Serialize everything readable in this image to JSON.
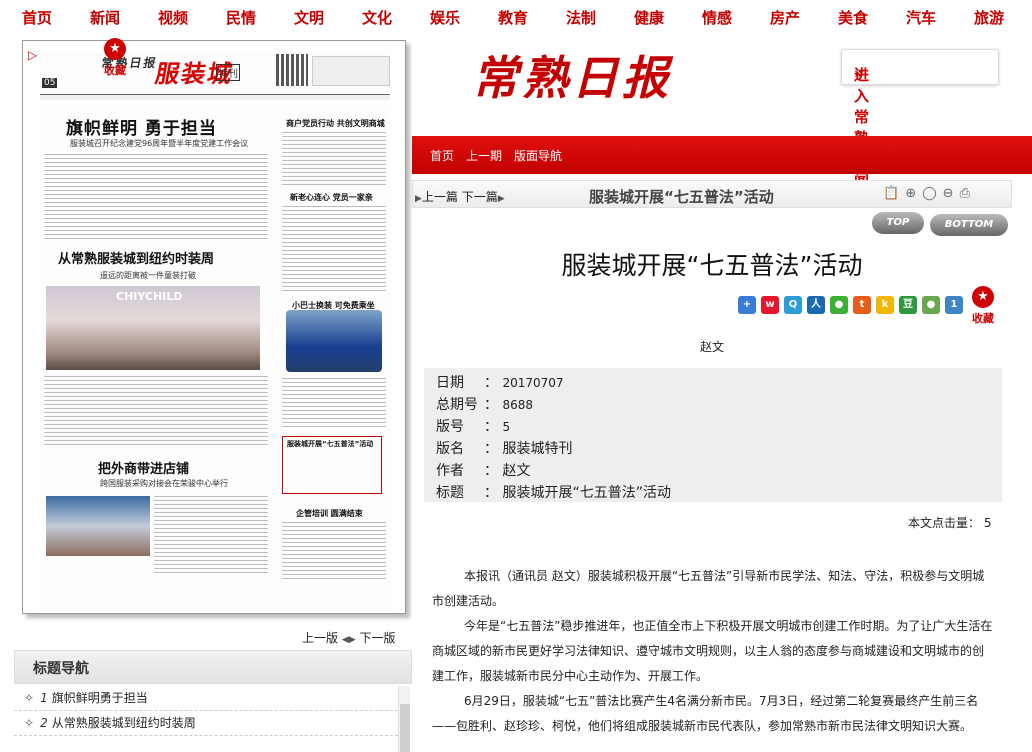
{
  "topnav": [
    "首页",
    "新闻",
    "视频",
    "民情",
    "文明",
    "文化",
    "娱乐",
    "教育",
    "法制",
    "健康",
    "情感",
    "房产",
    "美食",
    "汽车",
    "旅游"
  ],
  "colors": {
    "brand_red": "#c40000",
    "info_bg": "#eeeeee"
  },
  "paper": {
    "favorite_label": "收藏",
    "page_num": "05",
    "masthead_name": "服装城",
    "masthead_tag": "特刊",
    "masthead_logo": "常熟日报",
    "headline1": "旗帜鲜明  勇于担当",
    "sub1": "服装城召开纪念建党96周年暨半年度党建工作会议",
    "headline2": "从常熟服装城到纽约时装周",
    "sub2": "遥远的距离被一件童装打破",
    "photo_brand": "CHIYCHILD",
    "headline3": "把外商带进店铺",
    "sub3": "跨国服装采购对接会在荣骏中心举行",
    "side_head1": "商户党员行动  共创文明商城",
    "side_head2": "新老心连心  党员一家亲",
    "side_head3": "小巴士换装  可免费乘坐",
    "side_head4": "服装城开展“七五普法”活动",
    "side_head5": "企管培训  圆满结束",
    "prev_page": "上一版",
    "next_page": "下一版"
  },
  "title_nav": {
    "heading": "标题导航",
    "items": [
      {
        "num": "1",
        "title": "旗帜鲜明勇于担当"
      },
      {
        "num": "2",
        "title": "从常熟服装城到纽约时装周"
      }
    ]
  },
  "header": {
    "logo": "常熟日报",
    "go_news": "进入常熟新闻网",
    "nav": [
      "首页",
      "上一期",
      "版面导航"
    ]
  },
  "toolbar": {
    "prev": "上一篇",
    "next": "下一篇",
    "title": "服装城开展“七五普法”活动",
    "top_label": "TOP",
    "bottom_label": "BOTTOM"
  },
  "article": {
    "title": "服装城开展“七五普法”活动",
    "author": "赵文",
    "favorite_label": "收藏",
    "share_icons": [
      "plus-share-icon",
      "weibo-icon",
      "qzone-icon",
      "renren-icon",
      "wechat-icon",
      "tencent-weibo-icon",
      "kaixin-icon",
      "douban-icon",
      "bookmark-icon",
      "count-icon"
    ],
    "share_count": "1",
    "share_douban": "豆",
    "info": [
      {
        "key": "日期",
        "value": "20170707"
      },
      {
        "key": "总期号",
        "value": "8688"
      },
      {
        "key": "版号",
        "value": "5"
      },
      {
        "key": "版名",
        "value": "服装城特刊"
      },
      {
        "key": "作者",
        "value": "赵文"
      },
      {
        "key": "标题",
        "value": "服装城开展“七五普法”活动"
      }
    ],
    "clicks_label": "本文点击量：",
    "clicks": "5",
    "paragraphs": [
      "本报讯（通讯员 赵文）服装城积极开展“七五普法”引导新市民学法、知法、守法，积极参与文明城市创建活动。",
      "今年是“七五普法”稳步推进年，也正值全市上下积极开展文明城市创建工作时期。为了让广大生活在商城区域的新市民更好学习法律知识、遵守城市文明规则，以主人翁的态度参与商城建设和文明城市的创建工作，服装城新市民分中心主动作为、开展工作。",
      "6月29日，服装城“七五”普法比赛产生4名满分新市民。7月3日，经过第二轮复赛最终产生前三名——包胜利、赵珍珍、柯悦，他们将组成服装城新市民代表队，参加常熟市新市民法律文明知识大赛。"
    ]
  }
}
